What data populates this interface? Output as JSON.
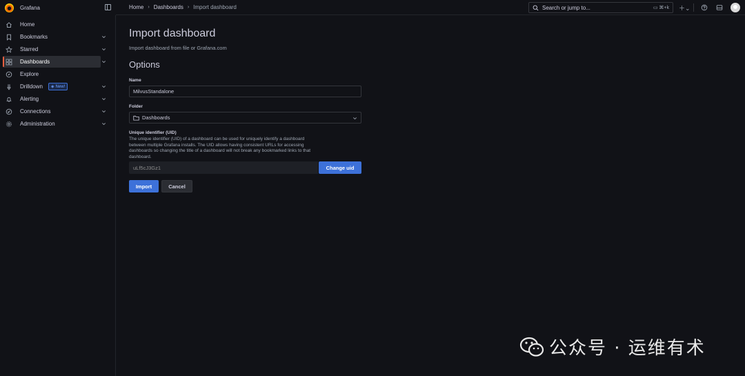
{
  "app": {
    "name": "Grafana"
  },
  "sidebar": {
    "items": [
      {
        "label": "Home",
        "icon": "home-icon",
        "has_chevron": false
      },
      {
        "label": "Bookmarks",
        "icon": "bookmark-icon",
        "has_chevron": true
      },
      {
        "label": "Starred",
        "icon": "star-icon",
        "has_chevron": true
      },
      {
        "label": "Dashboards",
        "icon": "apps-icon",
        "has_chevron": true,
        "active": true
      },
      {
        "label": "Explore",
        "icon": "compass-icon",
        "has_chevron": false
      },
      {
        "label": "Drilldown",
        "icon": "drilldown-icon",
        "has_chevron": true,
        "badge": "New!"
      },
      {
        "label": "Alerting",
        "icon": "bell-icon",
        "has_chevron": true
      },
      {
        "label": "Connections",
        "icon": "connections-icon",
        "has_chevron": true
      },
      {
        "label": "Administration",
        "icon": "cog-icon",
        "has_chevron": true
      }
    ]
  },
  "breadcrumb": [
    "Home",
    "Dashboards",
    "Import dashboard"
  ],
  "topbar": {
    "search_placeholder": "Search or jump to...",
    "shortcut": "⌘+k"
  },
  "page": {
    "title": "Import dashboard",
    "subtitle": "Import dashboard from file or Grafana.com",
    "section": "Options",
    "name_label": "Name",
    "name_value": "MilvusStandalone",
    "folder_label": "Folder",
    "folder_value": "Dashboards",
    "uid_label": "Unique identifier (UID)",
    "uid_description": "The unique identifier (UID) of a dashboard can be used for uniquely identify a dashboard between multiple Grafana installs. The UID allows having consistent URLs for accessing dashboards so changing the title of a dashboard will not break any bookmarked links to that dashboard.",
    "uid_value": "uLf5cJ3Gz1",
    "change_uid_label": "Change uid",
    "import_label": "Import",
    "cancel_label": "Cancel"
  },
  "watermark": {
    "text": "公众号 · 运维有术"
  },
  "colors": {
    "background": "#111217",
    "primary": "#3d71d9",
    "active_accent": "#f55f3e"
  }
}
